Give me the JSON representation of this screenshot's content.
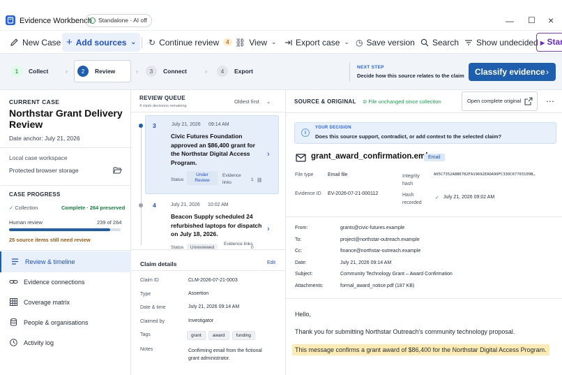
{
  "window": {
    "title": "Evidence Workbench",
    "mode_pill": "Standalone · AI off"
  },
  "toolbar": {
    "new_case": "New Case",
    "add_sources": "Add sources",
    "continue_review": "Continue review",
    "continue_count": "4",
    "view": "View",
    "export_case": "Export case",
    "save_version": "Save version",
    "search": "Search",
    "show_undecided": "Show undecided",
    "start": "Start"
  },
  "steps": [
    {
      "num": "1",
      "label": "Collect",
      "state": "done"
    },
    {
      "num": "2",
      "label": "Review",
      "state": "current"
    },
    {
      "num": "3",
      "label": "Connect",
      "state": "todo"
    },
    {
      "num": "4",
      "label": "Export",
      "state": "todo"
    }
  ],
  "next_step": {
    "label": "NEXT STEP",
    "desc": "Decide how this source relates to the claim",
    "button": "Classify evidence"
  },
  "case": {
    "label": "CURRENT CASE",
    "title": "Northstar Grant Delivery Review",
    "date_anchor": "Date anchor: July 21, 2026",
    "workspace": "Local case workspace",
    "storage": "Protected browser storage"
  },
  "progress": {
    "label": "CASE PROGRESS",
    "collection_label": "Collection",
    "collection_value": "Complete · 264 preserved",
    "human_review_label": "Human review",
    "human_review_value": "239 of 264",
    "reviewed": 239,
    "total": 264,
    "needs_review": "25 source items still need review"
  },
  "nav": [
    {
      "label": "Review & timeline",
      "icon": "list-icon",
      "active": true
    },
    {
      "label": "Evidence connections",
      "icon": "link-icon",
      "active": false
    },
    {
      "label": "Coverage matrix",
      "icon": "grid-icon",
      "active": false
    },
    {
      "label": "People & organisations",
      "icon": "database-icon",
      "active": false
    },
    {
      "label": "Activity log",
      "icon": "history-icon",
      "active": false
    }
  ],
  "queue": {
    "label": "REVIEW QUEUE",
    "sub": "4 claim decisions remaining",
    "sort": "Oldest first",
    "items": [
      {
        "num": "3",
        "date": "July 21, 2026",
        "time": "09:14 AM",
        "title": "Civic Futures Foundation approved an $86,400 grant for the Northstar Digital Access Program.",
        "status_label": "Status",
        "status": "Under Review",
        "links_label": "Evidence links",
        "links": "1"
      },
      {
        "num": "4",
        "date": "July 21, 2026",
        "time": "10:02 AM",
        "title": "Beacon Supply scheduled 24 refurbished laptops for dispatch on July 18, 2026.",
        "status_label": "Status",
        "status": "Unreviewed",
        "links_label": "Evidence links",
        "links": "0"
      }
    ]
  },
  "claim_details": {
    "title": "Claim details",
    "edit": "Edit",
    "rows": [
      {
        "k": "Claim ID",
        "v": "CLM-2026-07-21-0003"
      },
      {
        "k": "Type",
        "v": "Assertion"
      },
      {
        "k": "Date & time",
        "v": "July 21, 2026  09:14 AM"
      },
      {
        "k": "Claimed by",
        "v": "Investigator"
      }
    ],
    "tags_label": "Tags",
    "tags": [
      "grant",
      "award",
      "funding"
    ],
    "notes_label": "Notes",
    "notes": "Confirming email from the fictional grant administrator."
  },
  "source": {
    "label": "SOURCE & ORIGINAL",
    "unchanged": "File unchanged since collection",
    "open_original": "Open complete original",
    "decision_label": "YOUR DECISION",
    "decision_q": "Does this source support, contradict, or add context to the selected claim?",
    "filename": "grant_award_confirmation.eml",
    "chip": "Email",
    "file_type_label": "File type",
    "file_type": "Email file",
    "evidence_id_label": "Evidence ID",
    "evidence_id": "EV-2026-07-21-000112",
    "integrity_label": "Integrity hash",
    "integrity": "A05C7352A8B6782FA19692EADA90FC330C67703109B…",
    "hash_rec_label": "Hash recorded",
    "hash_rec": "July 21, 2026 09:02 AM",
    "headers": [
      {
        "k": "From:",
        "v": "grants@civic-futures.example"
      },
      {
        "k": "To:",
        "v": "project@northstar-outreach.example"
      },
      {
        "k": "Cc:",
        "v": "finance@northstar-outreach.example"
      },
      {
        "k": "Date:",
        "v": "July 21, 2026 09:14 AM"
      },
      {
        "k": "Subject:",
        "v": "Community Technology Grant – Award Confirmation"
      },
      {
        "k": "Attachments:",
        "v": "formal_award_notice.pdf (187 KB)"
      }
    ],
    "body_greeting": "Hello,",
    "body_line1": "Thank you for submitting Northstar Outreach's community technology proposal.",
    "body_highlight": "This message confirms a grant award of $86,400 for the Northstar Digital Access Program."
  }
}
